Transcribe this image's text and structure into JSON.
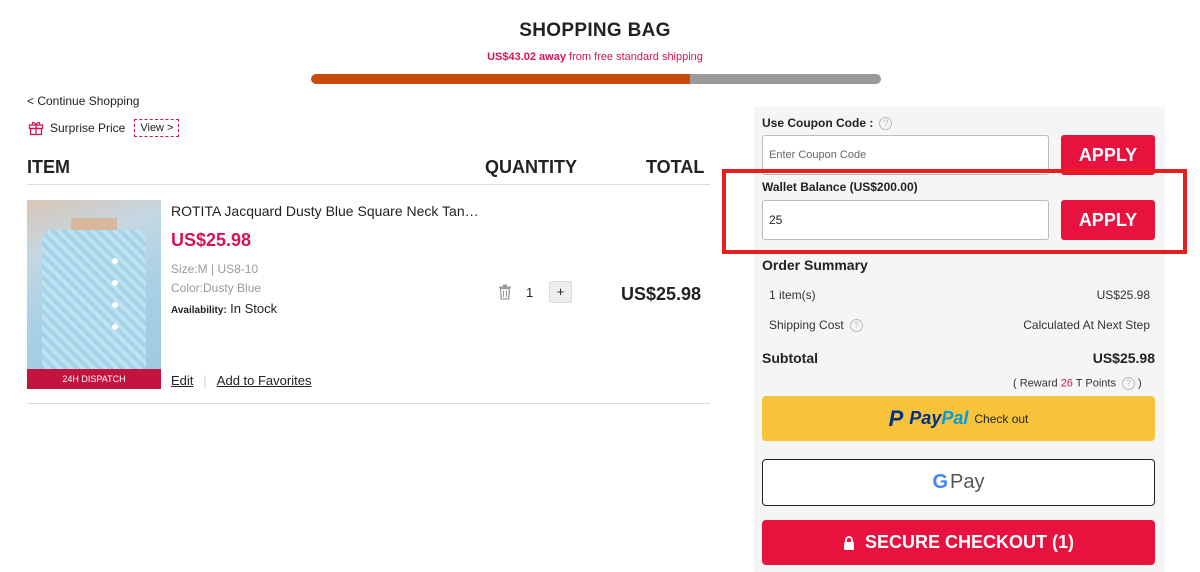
{
  "header": {
    "title": "SHOPPING BAG",
    "shipping_amount": "US$43.02 away",
    "shipping_suffix": " from free standard shipping",
    "shipping_progress": 0.665
  },
  "nav": {
    "continue_label": "< Continue Shopping",
    "surprise_label": "Surprise Price",
    "view_label": "View >"
  },
  "table": {
    "col_item": "ITEM",
    "col_quantity": "QUANTITY",
    "col_total": "TOTAL"
  },
  "item": {
    "name": "ROTITA Jacquard Dusty Blue Square Neck Tank Top",
    "price": "US$25.98",
    "size": "Size:M | US8-10",
    "color": "Color:Dusty Blue",
    "availability_label": "Availability:",
    "availability_value": "In Stock",
    "badge": "24H DISPATCH",
    "edit_label": "Edit",
    "favorites_label": "Add to Favorites",
    "quantity": "1",
    "plus_label": "+",
    "total": "US$25.98"
  },
  "coupon": {
    "label": "Use Coupon Code :",
    "placeholder": "Enter Coupon Code",
    "apply_label": "APPLY"
  },
  "wallet": {
    "label": "Wallet Balance (US$200.00)",
    "value": "25",
    "apply_label": "APPLY"
  },
  "summary": {
    "title": "Order Summary",
    "items_label": "1 item(s)",
    "items_value": "US$25.98",
    "shipping_label": "Shipping Cost",
    "shipping_value": "Calculated At Next Step",
    "subtotal_label": "Subtotal",
    "subtotal_value": "US$25.98",
    "reward_prefix": "( Reward ",
    "reward_points": "26",
    "reward_suffix": " T Points"
  },
  "payments": {
    "paypal_a": "Pay",
    "paypal_b": "Pal",
    "paypal_checkout": "Check out",
    "gpay_label": "Pay",
    "checkout_label": "SECURE CHECKOUT (1)"
  },
  "colors": {
    "accent": "#e8123f",
    "price": "#d4145a",
    "progress": "#c94a0a",
    "highlight": "#e81d1d",
    "paypal_bg": "#f6c33b"
  }
}
